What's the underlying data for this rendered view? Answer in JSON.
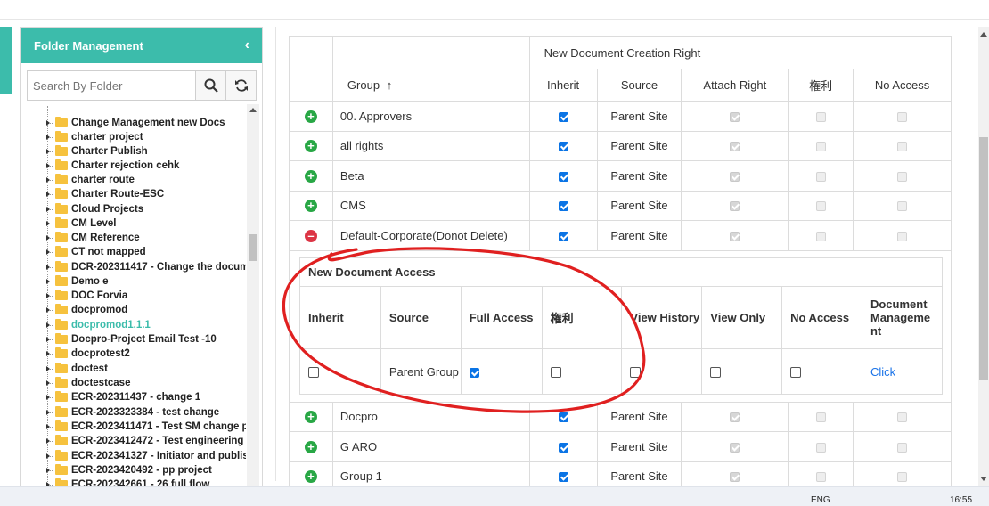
{
  "folder_panel": {
    "title": "Folder Management",
    "search_placeholder": "Search By Folder",
    "items": [
      {
        "label": "Change Management new Docs"
      },
      {
        "label": "charter project"
      },
      {
        "label": "Charter Publish"
      },
      {
        "label": "Charter rejection cehk"
      },
      {
        "label": "charter route"
      },
      {
        "label": "Charter Route-ESC"
      },
      {
        "label": "Cloud Projects"
      },
      {
        "label": "CM Level"
      },
      {
        "label": "CM Reference"
      },
      {
        "label": "CT not mapped"
      },
      {
        "label": "DCR-202311417 - Change the docume"
      },
      {
        "label": "Demo e"
      },
      {
        "label": "DOC Forvia"
      },
      {
        "label": "docpromod"
      },
      {
        "label": "docpromod1.1.1"
      },
      {
        "label": "Docpro-Project Email Test -10"
      },
      {
        "label": "docprotest2"
      },
      {
        "label": "doctest"
      },
      {
        "label": "doctestcase"
      },
      {
        "label": "ECR-202311437 - change 1"
      },
      {
        "label": "ECR-2023323384 - test change"
      },
      {
        "label": "ECR-2023411471 - Test SM change pro"
      },
      {
        "label": "ECR-2023412472 - Test engineering ch"
      },
      {
        "label": "ECR-202341327 - Initiator and publish"
      },
      {
        "label": "ECR-2023420492 - pp project"
      },
      {
        "label": "ECR-202342661 - 26 full flow"
      }
    ]
  },
  "rights_table": {
    "group_title": "New Document Creation Right",
    "columns": {
      "group": "Group",
      "inherit": "Inherit",
      "source": "Source",
      "attach": "Attach Right",
      "kenri": "権利",
      "noaccess": "No Access"
    },
    "rows": [
      {
        "name": "00. Approvers",
        "source": "Parent Site"
      },
      {
        "name": "all rights",
        "source": "Parent Site"
      },
      {
        "name": "Beta",
        "source": "Parent Site"
      },
      {
        "name": "CMS",
        "source": "Parent Site"
      },
      {
        "name": "Default-Corporate(Donot Delete)",
        "source": "Parent Site"
      },
      {
        "name": "Docpro",
        "source": "Parent Site"
      },
      {
        "name": "G ARO",
        "source": "Parent Site"
      },
      {
        "name": "Group 1",
        "source": "Parent Site"
      }
    ]
  },
  "sub_table": {
    "title": "New Document Access",
    "columns": {
      "inherit": "Inherit",
      "source": "Source",
      "full": "Full Access",
      "kenri": "権利",
      "history": "View History",
      "viewonly": "View Only",
      "noaccess": "No Access",
      "docmgmt": "Document Manageme nt"
    },
    "source_value": "Parent Group",
    "link": "Click"
  },
  "taskbar": {
    "lang": "ENG",
    "time": "16:55"
  },
  "colors": {
    "teal": "#3cbcab",
    "link": "#1a73e8",
    "annotation": "#e02020"
  }
}
